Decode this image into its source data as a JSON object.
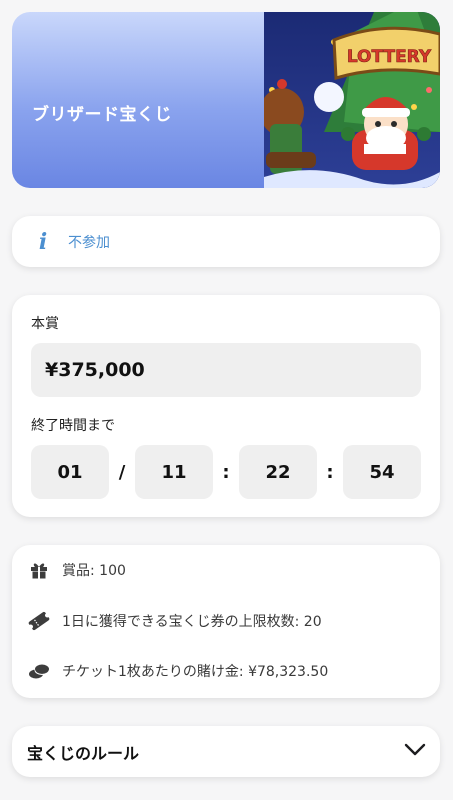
{
  "banner": {
    "title": "ブリザード宝くじ",
    "sign_text": "LOTTERY"
  },
  "status": {
    "icon": "info-icon",
    "glyph": "i",
    "text": "不参加"
  },
  "prize": {
    "label": "本賞",
    "amount": "¥375,000",
    "countdown_label": "終了時間まで",
    "countdown": {
      "days": "01",
      "hours": "11",
      "minutes": "22",
      "seconds": "54",
      "sep1": "/",
      "sep2": ":",
      "sep3": ":"
    }
  },
  "details": {
    "prizes": {
      "icon": "gift-icon",
      "text": "賞品: 100"
    },
    "ticket_limit": {
      "icon": "ticket-icon",
      "text": "1日に獲得できる宝くじ券の上限枚数: 20"
    },
    "bet_per_ticket": {
      "icon": "coins-icon",
      "text": "チケット1枚あたりの賭け金: ¥78,323.50"
    }
  },
  "rules": {
    "title": "宝くじのルール",
    "icon": "chevron-down-icon"
  },
  "colors": {
    "accent": "#4c8fd0",
    "banner_gradient_top": "#c9d7fb",
    "banner_gradient_bottom": "#6a86e3",
    "card_bg": "#ffffff",
    "field_bg": "#efefef"
  }
}
